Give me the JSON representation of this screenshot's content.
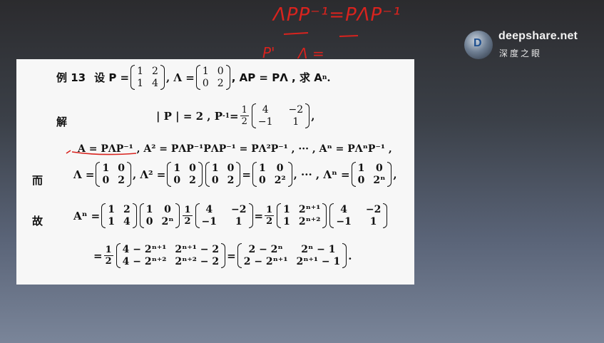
{
  "logo": {
    "name": "deepshare.net",
    "subtitle": "深度之眼"
  },
  "handwriting": {
    "top": "ΛPP⁻¹=PΛP⁻¹",
    "below_left": "P'",
    "below_mid": "Λ ="
  },
  "problem": {
    "line1": {
      "label": "例 13",
      "text_a": "设 P =",
      "P": [
        "1",
        "2",
        "1",
        "4"
      ],
      "text_b": ", Λ =",
      "L": [
        "1",
        "0",
        "0",
        "2"
      ],
      "text_c": ", AP = PΛ , 求 A",
      "sup_n": "n",
      "end": "."
    },
    "line2": {
      "label": "解",
      "text_a": "| P | = 2 , P",
      "sup_neg1": "-1",
      "text_b": " =",
      "frac_num": "1",
      "frac_den": "2",
      "M": [
        "4",
        "−2",
        "−1",
        "1"
      ],
      "end": ","
    },
    "line3": {
      "text": "A = PΛP⁻¹ , A² = PΛP⁻¹PΛP⁻¹ = PΛ²P⁻¹ , ··· , Aⁿ = PΛⁿP⁻¹ ,"
    },
    "line4": {
      "label": "而",
      "text_a": "Λ =",
      "M1": [
        "1",
        "0",
        "0",
        "2"
      ],
      "text_b": ", Λ² =",
      "M2": [
        "1",
        "0",
        "0",
        "2"
      ],
      "M3": [
        "1",
        "0",
        "0",
        "2"
      ],
      "eq": "=",
      "M4": [
        "1",
        "0",
        "0",
        "2²"
      ],
      "text_c": ", ··· , Λⁿ =",
      "M5": [
        "1",
        "0",
        "0",
        "2ⁿ"
      ],
      "end": ","
    },
    "line5": {
      "label": "故",
      "text_a": "Aⁿ =",
      "M1": [
        "1",
        "2",
        "1",
        "4"
      ],
      "M2": [
        "1",
        "0",
        "0",
        "2ⁿ"
      ],
      "frac_num": "1",
      "frac_den": "2",
      "M3": [
        "4",
        "−2",
        "−1",
        "1"
      ],
      "eq": "=",
      "frac2_num": "1",
      "frac2_den": "2",
      "M4": [
        "1",
        "2ⁿ⁺¹",
        "1",
        "2ⁿ⁺²"
      ],
      "M5": [
        "4",
        "−2",
        "−1",
        "1"
      ]
    },
    "line6": {
      "eq": "=",
      "frac_num": "1",
      "frac_den": "2",
      "M1": [
        "4 − 2ⁿ⁺¹",
        "2ⁿ⁺¹ − 2",
        "4 − 2ⁿ⁺²",
        "2ⁿ⁺² − 2"
      ],
      "eq2": "=",
      "M2": [
        "2 − 2ⁿ",
        "2ⁿ − 1",
        "2 − 2ⁿ⁺¹",
        "2ⁿ⁺¹ − 1"
      ],
      "end": "."
    }
  }
}
